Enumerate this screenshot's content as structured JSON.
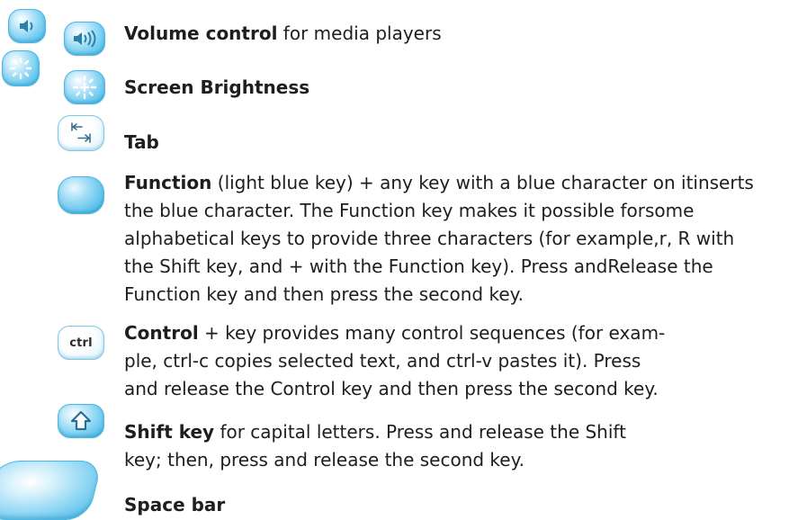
{
  "items": [
    {
      "title": "Volume control",
      "description": " for media players"
    },
    {
      "title": "Screen Brightness",
      "description": ""
    },
    {
      "title": "Tab",
      "description": ""
    },
    {
      "title": "Function",
      "description": " (light blue key) + any key with a blue character on itinserts\nthe blue character. The Function key makes it possible forsome\nalphabetical keys to provide three characters (for example,r, R with\nthe Shift key, and + with the Function key). Press andRelease the\nFunction key and then press the second key."
    },
    {
      "title": "Control",
      "description": " + key provides many control sequences (for exam-\nple, ctrl-c copies selected text, and ctrl-v pastes it). Press\nand release the Control key and then press the second key."
    },
    {
      "title": "Shift key",
      "description": " for capital letters. Press and release the Shift\nkey; then, press and release the second key."
    },
    {
      "title": "Space bar",
      "description": ""
    }
  ],
  "icons": {
    "volume_down": "volume-down-key-icon",
    "volume_up": "volume-up-key-icon",
    "brightness_down": "brightness-down-key-icon",
    "brightness_up": "brightness-up-key-icon",
    "tab": "tab-key-icon",
    "function": "function-key-icon",
    "control": "ctrl-key-icon",
    "shift": "shift-key-icon",
    "space": "space-bar-key-icon"
  },
  "ctrl_key_label": "ctrl",
  "colors": {
    "key_blue": "#3fb4e6",
    "text": "#1e1e1e"
  }
}
